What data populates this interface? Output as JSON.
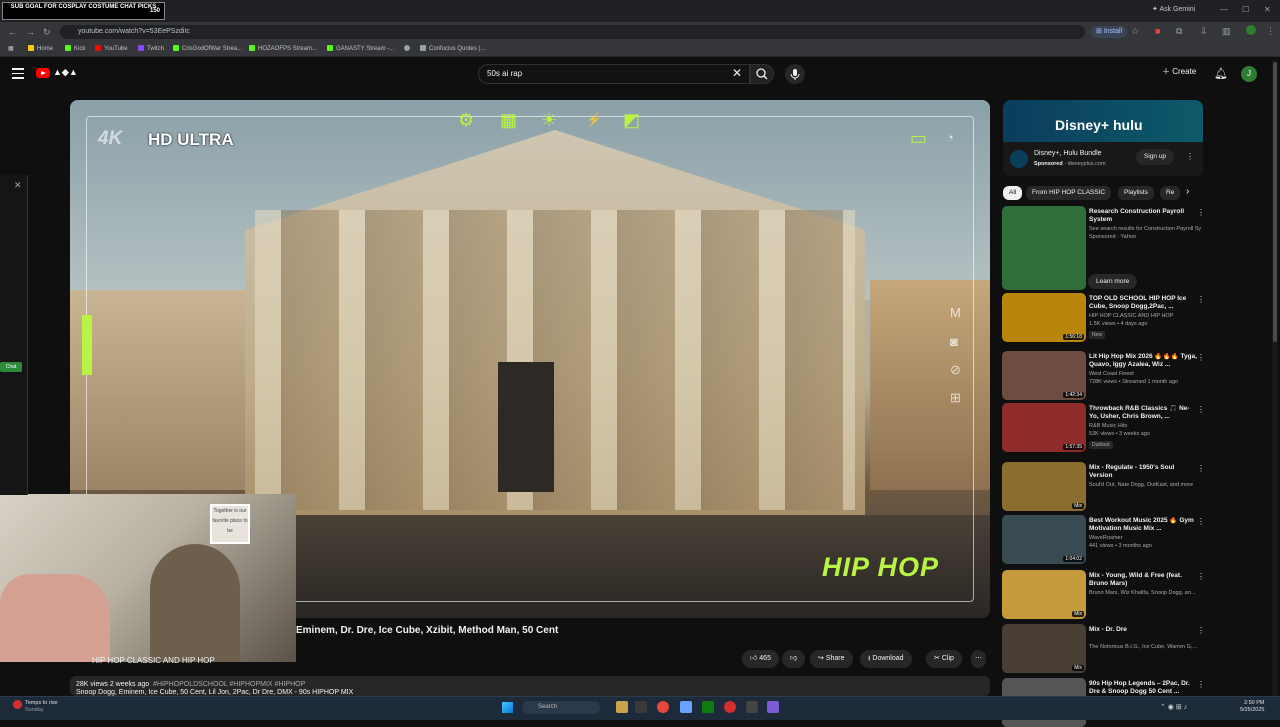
{
  "stream_overlay": {
    "goal_text": "SUB GOAL FOR COSPLAY COSTUME CHAT PICKS",
    "goal_count": "150"
  },
  "browser": {
    "url": "youtube.com/watch?v=53EePSzdiIc",
    "install_label": "Install",
    "ask_gemini_label": "Ask Gemini",
    "bookmarks": [
      "Home",
      "Kick",
      "YouTube",
      "Twitch",
      "CrisGodOfWar Strea...",
      "HOZAOFPS Stream...",
      "GANASTY Stream -...",
      "Confucius Quotes (..."
    ],
    "bookmark_colors": [
      "#ffcc00",
      "#53fc18",
      "#ff0000",
      "#9146ff",
      "#53fc18",
      "#53fc18",
      "#53fc18",
      "#9aa0a6"
    ]
  },
  "yt": {
    "search_query": "50s ai rap",
    "create_label": "Create",
    "avatar_letter": "J"
  },
  "video": {
    "hd_label": "HD ULTRA",
    "k4_label": "4K",
    "genre_logo": "HIP HOP",
    "title": "Eminem, Dr. Dre, Ice Cube, Xzibit, Method Man, 50 Cent",
    "channel": "HIP HOP CLASSIC AND HIP HOP",
    "likes": "465",
    "share_label": "Share",
    "download_label": "Download",
    "clip_label": "Clip",
    "stats": "28K views  2 weeks ago",
    "hashtags": "#HIPHOPOLDSCHOOL #HIPHOPMIX #HIPHOP",
    "desc_line": "Snoop Dogg, Eminem, Ice Cube, 50 Cent, Lil Jon, 2Pac, Dr Dre, DMX - 90s HIPHOP MIX"
  },
  "webcam": {
    "sign_text": "Together is our favorite place to be"
  },
  "chat": {
    "close_glyph": "✕",
    "chat_button": "Chat"
  },
  "ad": {
    "brand": "Disney+ hulu",
    "title": "Disney+, Hulu Bundle",
    "sponsored": "Sponsored",
    "domain": "disneyplus.com",
    "signup_label": "Sign up"
  },
  "chips": [
    "All",
    "From HIP HOP CLASSIC",
    "Playlists",
    "Re"
  ],
  "recommendations": [
    {
      "title": "Research Construction Payroll System",
      "channel": "See search results for Construction Payroll System",
      "meta": "Sponsored · Yahoo",
      "duration": "",
      "badge": "",
      "thumb": "#2f6d3a"
    },
    {
      "title": "TOP OLD SCHOOL HIP HOP Ice Cube, Snoop Dogg,2Pac, ...",
      "channel": "HIP HOP CLASSIC AND HIP HOP",
      "meta": "1.5K views • 4 days ago",
      "duration": "1:56:18",
      "badge": "New",
      "thumb": "#b8860b"
    },
    {
      "title": "Lit Hip Hop Mix 2026 🔥🔥🔥 Tyga, Quavo, Iggy Azalea, Wiz ...",
      "channel": "West Coast Finest",
      "meta": "728K views • Streamed 1 month ago",
      "duration": "1:42:34",
      "badge": "",
      "thumb": "#6d4c41"
    },
    {
      "title": "Throwback R&B Classics 🎵 Ne-Yo, Usher, Chris Brown, ...",
      "channel": "R&B Music Hits",
      "meta": "53K views • 3 weeks ago",
      "duration": "1:57:35",
      "badge": "Dubbed",
      "thumb": "#8e2b2b"
    },
    {
      "title": "Mix - Regulate - 1950's Soul Version",
      "channel": "Soul'd Out, Nate Dogg, OutKast, and more",
      "meta": "",
      "duration": "Mix",
      "badge": "",
      "thumb": "#8a6d2f"
    },
    {
      "title": "Best Workout Music 2025 🔥 Gym Motivation Music Mix ...",
      "channel": "WaveRoamer",
      "meta": "441 views • 3 months ago",
      "duration": "1:04:02",
      "badge": "",
      "thumb": "#3a4a52"
    },
    {
      "title": "Mix - Young, Wild & Free (feat. Bruno Mars)",
      "channel": "Bruno Mars, Wiz Khalifa, Snoop Dogg, an...",
      "meta": "",
      "duration": "Mix",
      "badge": "",
      "thumb": "#c49a3a"
    },
    {
      "title": "Mix - Dr. Dre",
      "channel": "The Notorious B.I.G., Ice Cube, Warren G,...",
      "meta": "",
      "duration": "Mix",
      "badge": "",
      "thumb": "#4a3f35"
    },
    {
      "title": "90s Hip Hop Legends – 2Pac, Dr. Dre & Snoop Dogg 50 Cent ...",
      "channel": "",
      "meta": "",
      "duration": "",
      "badge": "",
      "thumb": "#555"
    }
  ],
  "learn_more_label": "Learn more",
  "taskbar": {
    "weather_line1": "Temps to rise",
    "weather_line2": "Sunday",
    "search_placeholder": "Search",
    "time": "2:50 PM",
    "date": "5/25/2025"
  }
}
